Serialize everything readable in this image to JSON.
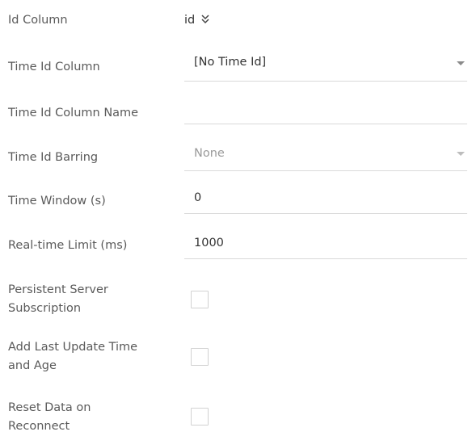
{
  "fields": {
    "id_column": {
      "label": "Id Column",
      "value": "id",
      "icon": "double-chevron-down-icon"
    },
    "time_id_column": {
      "label": "Time Id Column",
      "value": "[No Time Id]",
      "icon": "dropdown-caret-icon"
    },
    "time_id_column_name": {
      "label": "Time Id Column Name",
      "value": ""
    },
    "time_id_barring": {
      "label": "Time Id Barring",
      "value": "None",
      "icon": "dropdown-caret-icon"
    },
    "time_window": {
      "label": "Time Window (s)",
      "value": "0"
    },
    "realtime_limit": {
      "label": "Real-time Limit (ms)",
      "value": "1000"
    },
    "persistent_subscription": {
      "label_line1": "Persistent Server",
      "label_line2": "Subscription",
      "checked": false
    },
    "add_last_update": {
      "label_line1": "Add Last Update Time",
      "label_line2": "and Age",
      "checked": false
    },
    "reset_data": {
      "label_line1": "Reset Data on",
      "label_line2": "Reconnect",
      "checked": false
    }
  },
  "colors": {
    "label": "#5a5a5a",
    "value": "#333333",
    "muted_value": "#9a9a9a",
    "underline": "#d9d9d9",
    "checkbox_border": "#d2d2d2"
  }
}
